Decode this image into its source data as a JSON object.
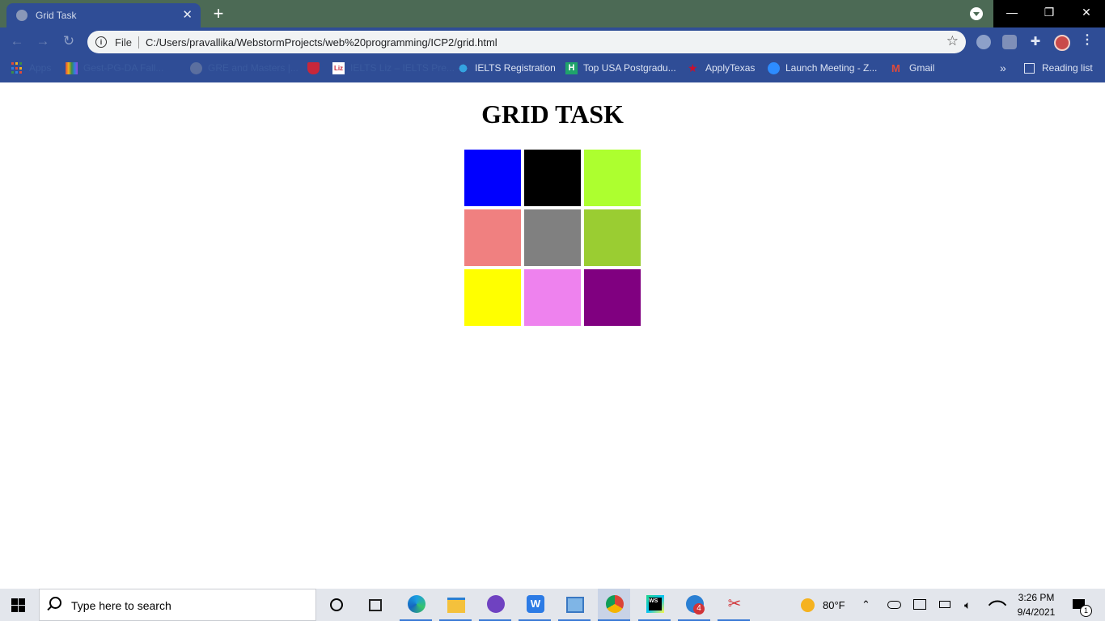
{
  "browser": {
    "tab_title": "Grid Task",
    "new_tab": "+",
    "address_scheme_label": "File",
    "address_url": "C:/Users/pravallika/WebstormProjects/web%20programming/ICP2/grid.html"
  },
  "bookmarks": {
    "items": [
      {
        "label": "Apps",
        "dim": true
      },
      {
        "label": "Gest-PG-DA Fall...",
        "dim": true
      },
      {
        "label": "GRE and Masters |...",
        "dim": true
      },
      {
        "label": "",
        "dim": false
      },
      {
        "label": "IELTS Liz – IELTS Pre...",
        "dim": true
      },
      {
        "label": "IELTS Registration",
        "dim": false
      },
      {
        "label": "Top USA Postgradu...",
        "dim": false
      },
      {
        "label": "ApplyTexas",
        "dim": false
      },
      {
        "label": "Launch Meeting - Z...",
        "dim": false
      },
      {
        "label": "Gmail",
        "dim": false
      }
    ],
    "overflow": "»",
    "reading_list": "Reading list"
  },
  "page": {
    "heading": "GRID TASK",
    "cells": [
      "#0000ff",
      "#000000",
      "#adff2f",
      "#f08080",
      "#808080",
      "#9acd32",
      "#ffff00",
      "#ee82ee",
      "#800080"
    ]
  },
  "taskbar": {
    "search_placeholder": "Type here to search",
    "weather": "80°F",
    "time": "3:26 PM",
    "date": "9/4/2021",
    "mail_badge": "4",
    "notification_count": "1"
  }
}
